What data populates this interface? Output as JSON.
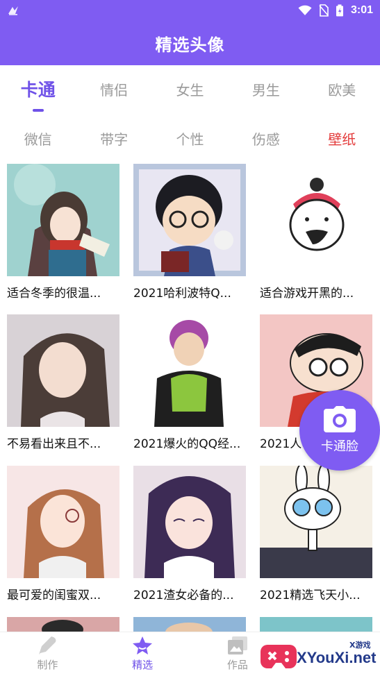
{
  "status_bar": {
    "time": "3:01"
  },
  "header": {
    "title": "精选头像"
  },
  "category_tabs_row1": [
    {
      "label": "卡通",
      "active": true
    },
    {
      "label": "情侣"
    },
    {
      "label": "女生"
    },
    {
      "label": "男生"
    },
    {
      "label": "欧美"
    }
  ],
  "category_tabs_row2": [
    {
      "label": "微信"
    },
    {
      "label": "带字"
    },
    {
      "label": "个性"
    },
    {
      "label": "伤感"
    },
    {
      "label": "壁纸",
      "highlight": true
    }
  ],
  "cards": [
    {
      "caption": "适合冬季的很温..."
    },
    {
      "caption": "2021哈利波特Q..."
    },
    {
      "caption": "适合游戏开黑的..."
    },
    {
      "caption": "不易看出来且不..."
    },
    {
      "caption": "2021爆火的QQ经..."
    },
    {
      "caption": "2021人"
    },
    {
      "caption": "最可爱的闺蜜双..."
    },
    {
      "caption": "2021渣女必备的..."
    },
    {
      "caption": "2021精选飞天小..."
    }
  ],
  "fab": {
    "label": "卡通脸"
  },
  "bottom_nav": [
    {
      "label": "制作"
    },
    {
      "label": "精选",
      "active": true
    },
    {
      "label": "作品"
    }
  ],
  "watermark": {
    "text": "XYouXi.net",
    "small": "X游戏"
  },
  "colors": {
    "accent": "#7f5cf2",
    "active_tab": "#6f52e8",
    "highlight_tab": "#e33a3a"
  }
}
